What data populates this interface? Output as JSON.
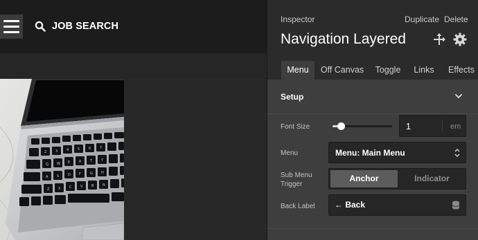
{
  "canvas": {
    "search_label": "JOB SEARCH",
    "menu_icon": "hamburger-icon",
    "search_icon": "search-icon"
  },
  "inspector": {
    "caption": "Inspector",
    "duplicate_label": "Duplicate",
    "delete_label": "Delete",
    "title": "Navigation Layered",
    "move_icon": "move-arrows-icon",
    "settings_icon": "gear-icon",
    "tabs": [
      {
        "label": "Menu",
        "active": true
      },
      {
        "label": "Off Canvas",
        "active": false
      },
      {
        "label": "Toggle",
        "active": false
      },
      {
        "label": "Links",
        "active": false
      },
      {
        "label": "Effects",
        "active": false
      }
    ],
    "section": {
      "title": "Setup",
      "expanded": true,
      "fields": {
        "font_size": {
          "label": "Font Size",
          "value": "1",
          "unit": "em",
          "slider_fraction": 0.14
        },
        "menu": {
          "label": "Menu",
          "value": "Menu: Main Menu"
        },
        "sub_menu_trigger": {
          "label_line1": "Sub Menu",
          "label_line2": "Trigger",
          "options": [
            "Anchor",
            "Indicator"
          ],
          "selected": "Anchor"
        },
        "back_label": {
          "label": "Back Label",
          "value": "← Back"
        }
      }
    }
  },
  "colors": {
    "panel_bg": "#3e3e3e",
    "header_bg": "#2b2b2b",
    "canvas_topbar": "#1c1c1c",
    "input_bg": "#262626",
    "text_primary": "#ffffff"
  }
}
